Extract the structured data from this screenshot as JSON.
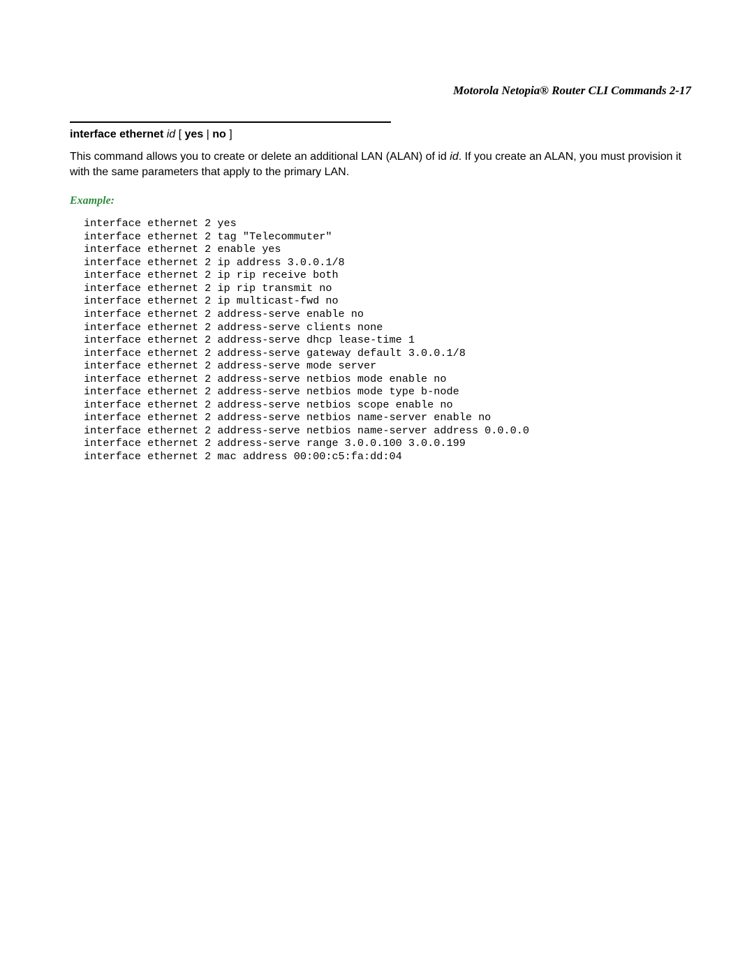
{
  "header": {
    "title": "Motorola Netopia® Router CLI Commands   2-17"
  },
  "command": {
    "name": "interface ethernet",
    "arg": "id",
    "lb": " [ ",
    "opt1": "yes",
    "pipe": " | ",
    "opt2": "no",
    "rb": " ]"
  },
  "desc": {
    "t1": "This command allows you to create or delete an additional LAN (ALAN) of id ",
    "id": "id",
    "t2": ". If you create an ALAN, you must provision it with the same parameters that apply to the primary LAN."
  },
  "example": {
    "heading": "Example:",
    "code": "interface ethernet 2 yes\ninterface ethernet 2 tag \"Telecommuter\"\ninterface ethernet 2 enable yes\ninterface ethernet 2 ip address 3.0.0.1/8\ninterface ethernet 2 ip rip receive both\ninterface ethernet 2 ip rip transmit no\ninterface ethernet 2 ip multicast-fwd no\ninterface ethernet 2 address-serve enable no\ninterface ethernet 2 address-serve clients none\ninterface ethernet 2 address-serve dhcp lease-time 1\ninterface ethernet 2 address-serve gateway default 3.0.0.1/8\ninterface ethernet 2 address-serve mode server\ninterface ethernet 2 address-serve netbios mode enable no\ninterface ethernet 2 address-serve netbios mode type b-node\ninterface ethernet 2 address-serve netbios scope enable no\ninterface ethernet 2 address-serve netbios name-server enable no\ninterface ethernet 2 address-serve netbios name-server address 0.0.0.0\ninterface ethernet 2 address-serve range 3.0.0.100 3.0.0.199\ninterface ethernet 2 mac address 00:00:c5:fa:dd:04"
  }
}
